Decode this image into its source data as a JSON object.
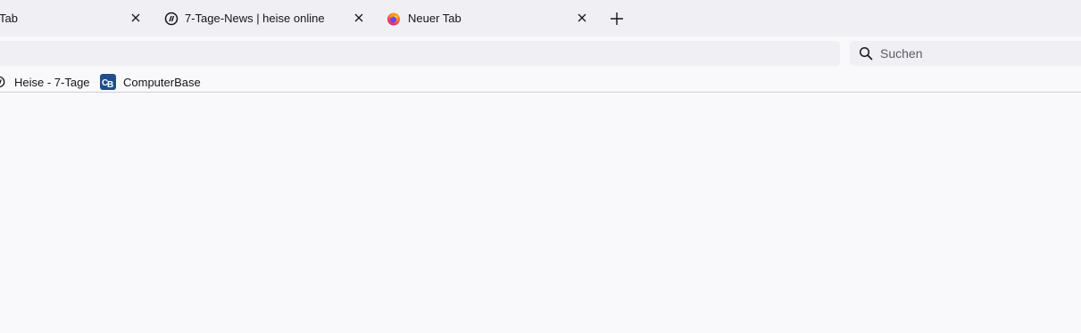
{
  "tabs": [
    {
      "label": "Tab",
      "favicon": "none"
    },
    {
      "label": "7-Tage-News | heise online",
      "favicon": "heise-icon"
    },
    {
      "label": "Neuer Tab",
      "favicon": "firefox-icon"
    }
  ],
  "search": {
    "placeholder": "Suchen"
  },
  "bookmarks": [
    {
      "label": "Heise - 7-Tage",
      "icon": "heise-icon"
    },
    {
      "label": "ComputerBase",
      "icon": "computerbase-icon"
    }
  ],
  "colors": {
    "tabbar_bg": "#f0f0f4",
    "toolbar_bg": "#f9f9fb",
    "text": "#15141a",
    "placeholder": "#5b5b66",
    "computerbase_blue": "#1f4e8c"
  }
}
